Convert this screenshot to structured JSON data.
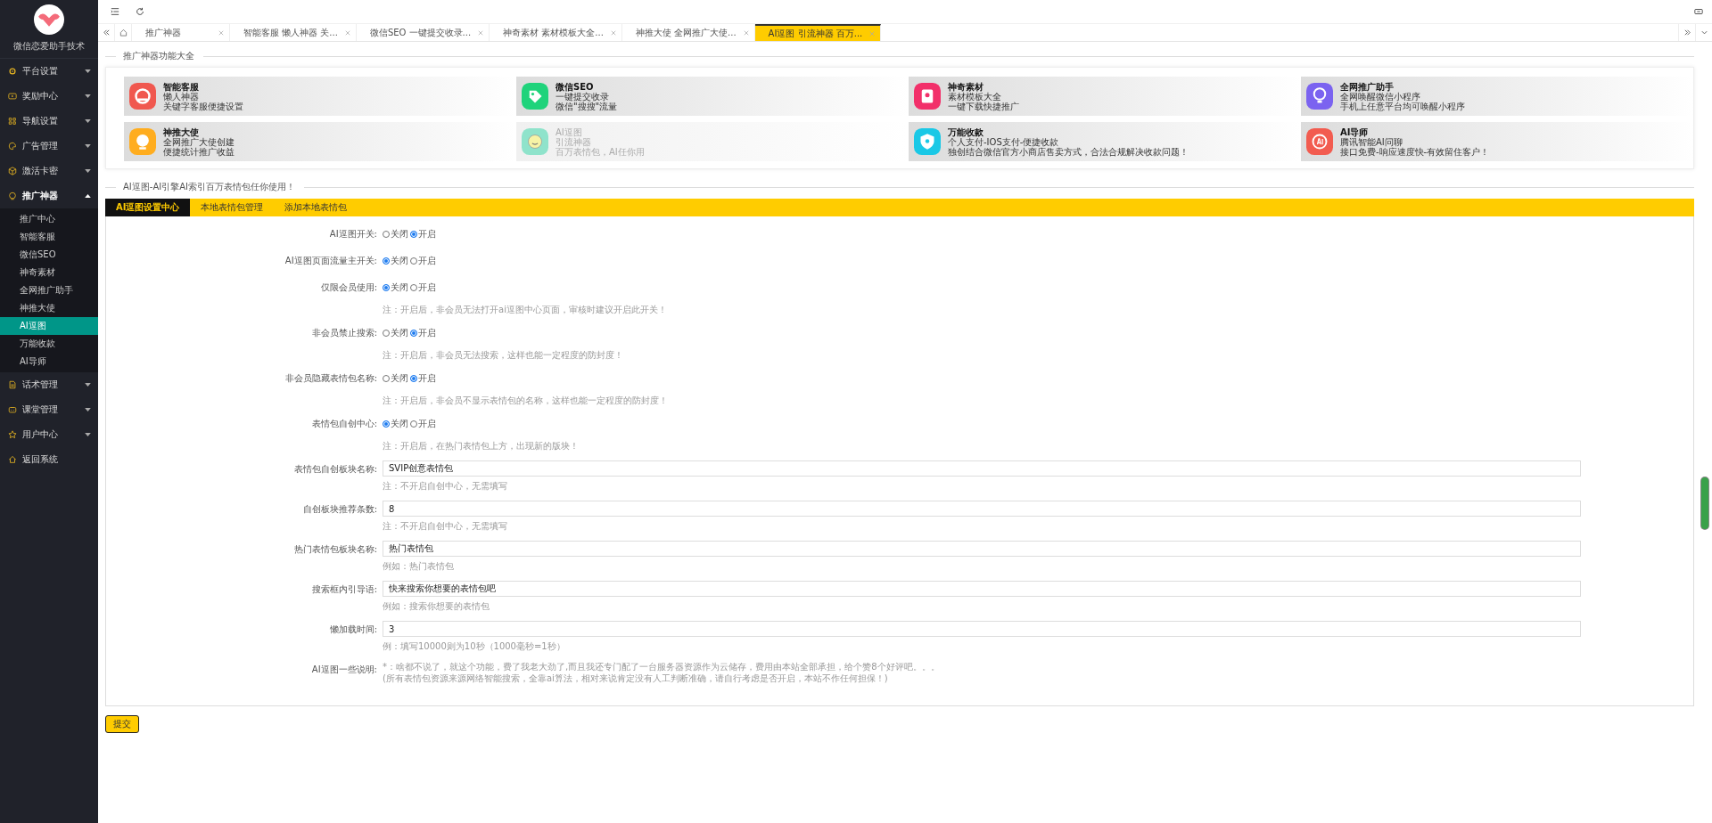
{
  "sidebar": {
    "logo_caption": "微信恋爱助手技术",
    "menu": [
      {
        "label": "平台设置",
        "expanded": false
      },
      {
        "label": "奖励中心",
        "expanded": false
      },
      {
        "label": "导航设置",
        "expanded": false
      },
      {
        "label": "广告管理",
        "expanded": false
      },
      {
        "label": "激活卡密",
        "expanded": false
      },
      {
        "label": "推广神器",
        "expanded": true,
        "children": [
          {
            "label": "推广中心",
            "selected": false
          },
          {
            "label": "智能客服",
            "selected": false
          },
          {
            "label": "微信SEO",
            "selected": false
          },
          {
            "label": "神奇素材",
            "selected": false
          },
          {
            "label": "全网推广助手",
            "selected": false
          },
          {
            "label": "神推大使",
            "selected": false
          },
          {
            "label": "AI逗图",
            "selected": true
          },
          {
            "label": "万能收款",
            "selected": false
          },
          {
            "label": "AI导师",
            "selected": false
          }
        ]
      },
      {
        "label": "话术管理",
        "expanded": false
      },
      {
        "label": "课堂管理",
        "expanded": false
      },
      {
        "label": "用户中心",
        "expanded": false
      },
      {
        "label": "返回系统"
      }
    ]
  },
  "tabs": [
    {
      "label": "推广神器",
      "selected": false
    },
    {
      "label": "智能客服 懒人神器 关...",
      "selected": false
    },
    {
      "label": "微信SEO 一键提交收录...",
      "selected": false
    },
    {
      "label": "神奇素材 素材模板大全...",
      "selected": false
    },
    {
      "label": "神推大使 全网推广大使...",
      "selected": false
    },
    {
      "label": "AI逗图 引流神器 百万...",
      "selected": true
    }
  ],
  "features": {
    "title": "推广神器功能大全",
    "cards": [
      {
        "title": "智能客服",
        "line1": "懒人神器",
        "line2": "关键字客服便捷设置",
        "color": "#f0584f",
        "selected": false
      },
      {
        "title": "微信SEO",
        "line1": "一键提交收录",
        "line2": "微信\"搜搜\"流量",
        "color": "#1fd37b",
        "selected": false
      },
      {
        "title": "神奇素材",
        "line1": "素材模板大全",
        "line2": "一键下载快捷推广",
        "color": "#f2306a",
        "selected": false
      },
      {
        "title": "全网推广助手",
        "line1": "全网唤醒微信小程序",
        "line2": "手机上任意平台均可唤醒小程序",
        "color": "#7b63f0",
        "selected": false
      },
      {
        "title": "神推大使",
        "line1": "全网推广大使创建",
        "line2": "便捷统计推广收益",
        "color": "#ffad1f",
        "selected": false
      },
      {
        "title": "AI逗图",
        "line1": "引流神器",
        "line2": "百万表情包，AI任你用",
        "color": "#8fe3cb",
        "selected": true
      },
      {
        "title": "万能收款",
        "line1": "个人支付-IOS支付-便捷收款",
        "line2": "独创结合微信官方小商店售卖方式，合法合规解决收款问题！",
        "color": "#1ac8e6",
        "selected": false
      },
      {
        "title": "AI导师",
        "line1": "腾讯智能AI问聊",
        "line2": "接口免费-响应速度快-有效留住客户！",
        "color": "#f25c50",
        "selected": false
      }
    ]
  },
  "settings": {
    "title": "AI逗图-AI引擎AI索引百万表情包任你使用！",
    "subtabs": [
      {
        "label": "AI逗图设置中心",
        "selected": true
      },
      {
        "label": "本地表情包管理",
        "selected": false
      },
      {
        "label": "添加本地表情包",
        "selected": false
      }
    ],
    "rows": [
      {
        "kind": "radio",
        "label": "AI逗图开关:",
        "options": [
          {
            "label": "关闭",
            "selected": false
          },
          {
            "label": "开启",
            "selected": true
          }
        ]
      },
      {
        "kind": "radio",
        "label": "AI逗图页面流量主开关:",
        "options": [
          {
            "label": "关闭",
            "selected": true
          },
          {
            "label": "开启",
            "selected": false
          }
        ]
      },
      {
        "kind": "radio",
        "label": "仅限会员使用:",
        "options": [
          {
            "label": "关闭",
            "selected": true
          },
          {
            "label": "开启",
            "selected": false
          }
        ],
        "note": "注：开启后，非会员无法打开ai逗图中心页面，审核时建议开启此开关！"
      },
      {
        "kind": "radio",
        "label": "非会员禁止搜索:",
        "options": [
          {
            "label": "关闭",
            "selected": false
          },
          {
            "label": "开启",
            "selected": true
          }
        ],
        "note": "注：开启后，非会员无法搜索，这样也能一定程度的防封度！"
      },
      {
        "kind": "radio",
        "label": "非会员隐藏表情包名称:",
        "options": [
          {
            "label": "关闭",
            "selected": false
          },
          {
            "label": "开启",
            "selected": true
          }
        ],
        "note": "注：开启后，非会员不显示表情包的名称，这样也能一定程度的防封度！"
      },
      {
        "kind": "radio",
        "label": "表情包自创中心:",
        "options": [
          {
            "label": "关闭",
            "selected": true
          },
          {
            "label": "开启",
            "selected": false
          }
        ],
        "note": "注：开启后，在热门表情包上方，出现新的版块！"
      },
      {
        "kind": "text",
        "label": "表情包自创板块名称:",
        "value": "SVIP创意表情包",
        "note": "注：不开启自创中心，无需填写"
      },
      {
        "kind": "text",
        "label": "自创板块推荐条数:",
        "value": "8",
        "note": "注：不开启自创中心，无需填写"
      },
      {
        "kind": "text",
        "label": "热门表情包板块名称:",
        "value": "热门表情包",
        "note": "例如：热门表情包"
      },
      {
        "kind": "text",
        "label": "搜索框内引导语:",
        "value": "快来搜索你想要的表情包吧",
        "note": "例如：搜索你想要的表情包"
      },
      {
        "kind": "text",
        "label": "懒加载时间:",
        "value": "3",
        "note": "例：填写10000则为10秒（1000毫秒=1秒）"
      },
      {
        "kind": "description",
        "label": "AI逗图一些说明:",
        "lines": [
          "*：啥都不说了，就这个功能，费了我老大劲了,而且我还专门配了一台服务器资源作为云储存，费用由本站全部承担，给个赞8个好评吧。。。",
          "(所有表情包资源来源网络智能搜索，全靠ai算法，相对来说肯定没有人工判断准确，请自行考虑是否开启，本站不作任何担保！)"
        ]
      }
    ],
    "submit": "提交"
  }
}
